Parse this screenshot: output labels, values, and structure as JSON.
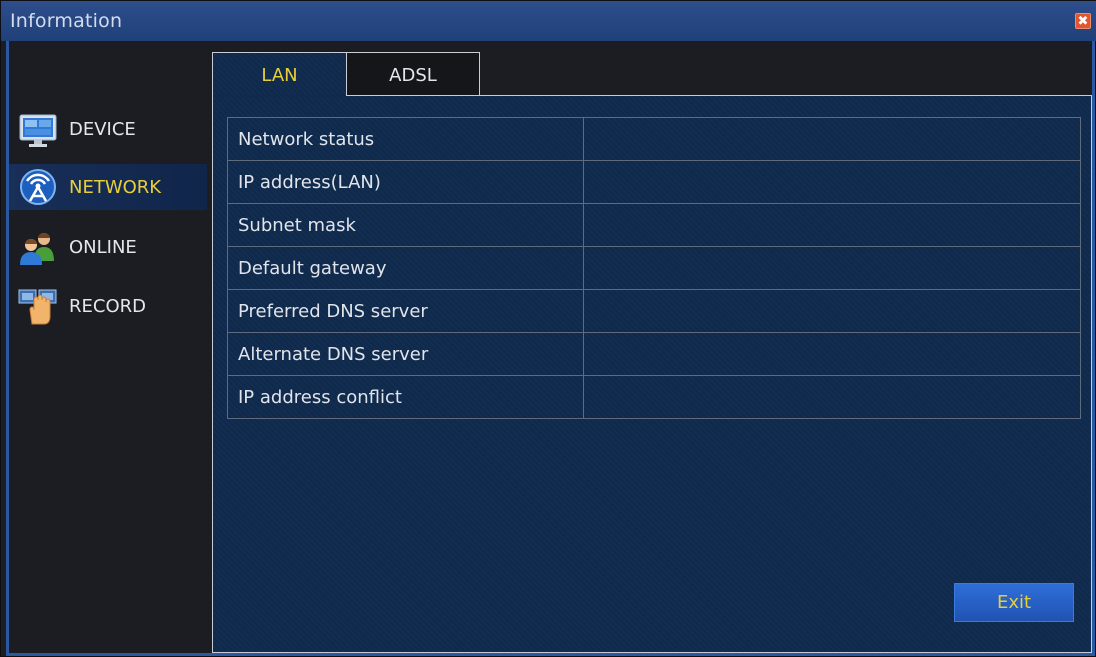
{
  "window": {
    "title": "Information",
    "close_glyph": "✖"
  },
  "sidebar": {
    "items": [
      {
        "label": "DEVICE",
        "icon": "monitor-icon"
      },
      {
        "label": "NETWORK",
        "icon": "antenna-icon",
        "active": true
      },
      {
        "label": "ONLINE",
        "icon": "users-icon"
      },
      {
        "label": "RECORD",
        "icon": "hand-record-icon"
      }
    ]
  },
  "tabs": [
    {
      "label": "LAN",
      "active": true
    },
    {
      "label": "ADSL",
      "active": false
    }
  ],
  "table": {
    "rows": [
      {
        "label": "Network status",
        "value": ""
      },
      {
        "label": "IP address(LAN)",
        "value": ""
      },
      {
        "label": "Subnet mask",
        "value": ""
      },
      {
        "label": "Default gateway",
        "value": ""
      },
      {
        "label": "Preferred DNS server",
        "value": ""
      },
      {
        "label": "Alternate DNS server",
        "value": ""
      },
      {
        "label": "IP address conflict",
        "value": ""
      }
    ]
  },
  "buttons": {
    "exit_label": "Exit"
  },
  "colors": {
    "accent_yellow": "#e8cf3a",
    "titlebar_blue": "#2a4c8a",
    "panel_navy": "#0f2a4c",
    "close_red": "#e2552f"
  }
}
